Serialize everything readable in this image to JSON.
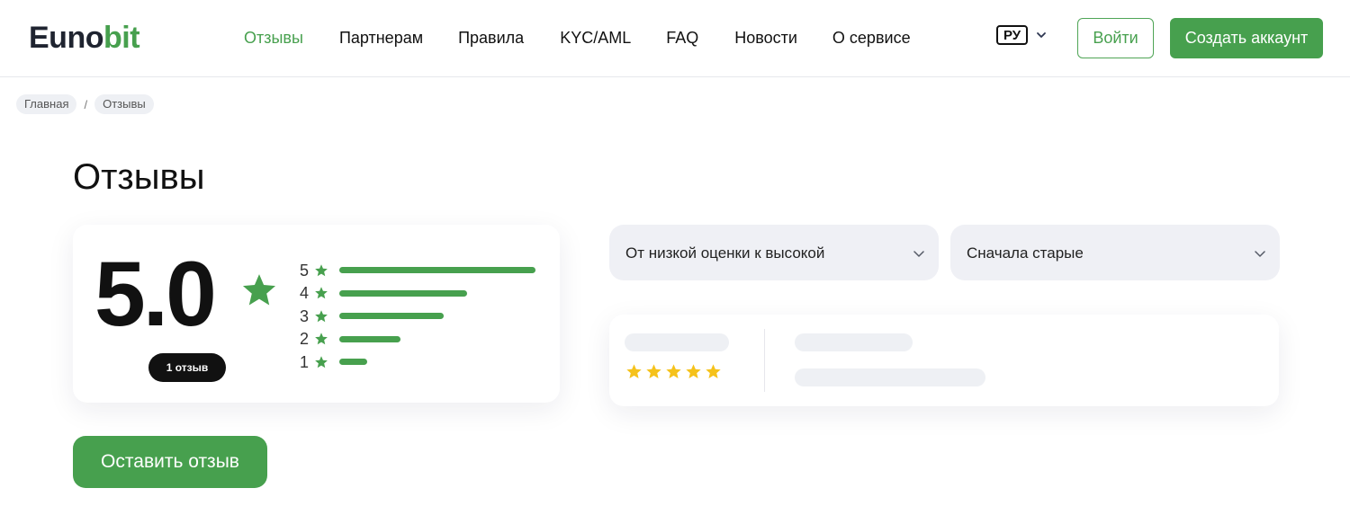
{
  "header": {
    "logo_part1": "Euno",
    "logo_part2": "bit",
    "nav": [
      "Отзывы",
      "Партнерам",
      "Правила",
      "KYC/AML",
      "FAQ",
      "Новости",
      "О сервисе"
    ],
    "lang": "РУ",
    "login_label": "Войти",
    "create_label": "Создать аккаунт"
  },
  "breadcrumb": {
    "home": "Главная",
    "separator": "/",
    "current": "Отзывы"
  },
  "page_title": "Отзывы",
  "rating": {
    "score": "5.0",
    "count_label": "1 отзыв",
    "distribution": [
      {
        "stars": "5",
        "fraction": 1.0
      },
      {
        "stars": "4",
        "fraction": 0.65
      },
      {
        "stars": "3",
        "fraction": 0.53
      },
      {
        "stars": "2",
        "fraction": 0.31
      },
      {
        "stars": "1",
        "fraction": 0.14
      }
    ]
  },
  "filters": {
    "rating_sort": "От низкой оценки к высокой",
    "date_sort": "Сначала старые"
  },
  "review_placeholder": {
    "stars": 5
  },
  "leave_review_label": "Оставить отзыв",
  "colors": {
    "accent": "#47a04e",
    "star_yellow": "#f5c21b"
  }
}
